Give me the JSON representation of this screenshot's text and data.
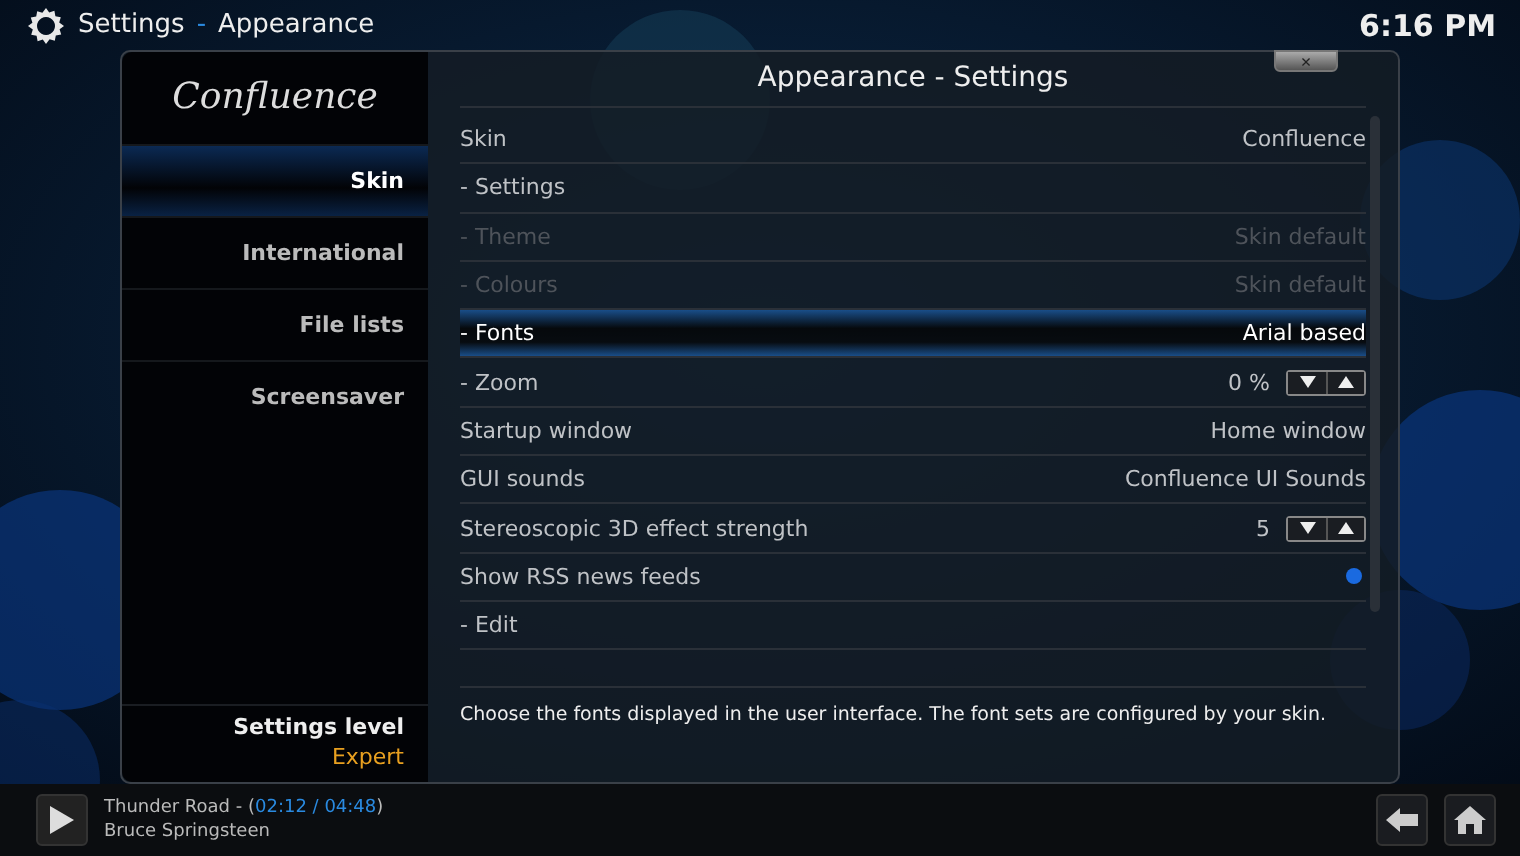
{
  "header": {
    "section": "Settings",
    "separator": "-",
    "page": "Appearance",
    "clock": "6:16 PM"
  },
  "dialog": {
    "title": "Appearance - Settings",
    "close": "×",
    "logo": "Confluence",
    "sidebar": {
      "items": [
        {
          "label": "Skin",
          "selected": true
        },
        {
          "label": "International",
          "selected": false
        },
        {
          "label": "File lists",
          "selected": false
        },
        {
          "label": "Screensaver",
          "selected": false
        }
      ],
      "settings_level_label": "Settings level",
      "settings_level": "Expert"
    },
    "rows": [
      {
        "kind": "value",
        "label": "Skin",
        "value": "Confluence",
        "disabled": false,
        "selected": false
      },
      {
        "kind": "plain",
        "label": "- Settings",
        "disabled": false,
        "selected": false
      },
      {
        "kind": "value",
        "label": "- Theme",
        "value": "Skin default",
        "disabled": true,
        "selected": false
      },
      {
        "kind": "value",
        "label": "- Colours",
        "value": "Skin default",
        "disabled": true,
        "selected": false
      },
      {
        "kind": "value",
        "label": "- Fonts",
        "value": "Arial based",
        "disabled": false,
        "selected": true
      },
      {
        "kind": "spin",
        "label": "- Zoom",
        "value": "0 %",
        "disabled": false,
        "selected": false
      },
      {
        "kind": "value",
        "label": "Startup window",
        "value": "Home window",
        "disabled": false,
        "selected": false
      },
      {
        "kind": "value",
        "label": "GUI sounds",
        "value": "Confluence UI Sounds",
        "disabled": false,
        "selected": false
      },
      {
        "kind": "spin",
        "label": "Stereoscopic 3D effect strength",
        "value": "5",
        "disabled": false,
        "selected": false
      },
      {
        "kind": "toggle",
        "label": "Show RSS news feeds",
        "on": true,
        "disabled": false,
        "selected": false
      },
      {
        "kind": "plain",
        "label": "- Edit",
        "disabled": false,
        "selected": false
      }
    ],
    "description": "Choose the fonts displayed in the user interface. The font sets are configured by your skin."
  },
  "now_playing": {
    "title": "Thunder Road - (",
    "time": "02:12 / 04:48",
    "close_paren": ")",
    "artist": "Bruce Springsteen"
  }
}
